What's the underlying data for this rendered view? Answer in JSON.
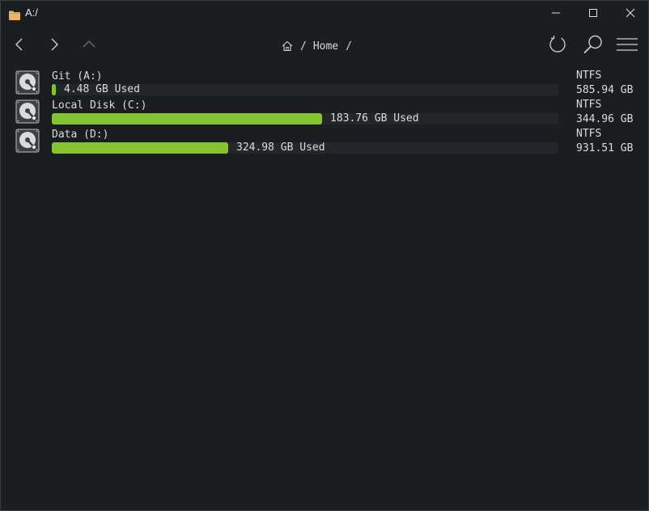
{
  "window": {
    "title": "A:/",
    "icon": "folder-icon"
  },
  "toolbar": {
    "back_icon": "chevron-left-icon",
    "forward_icon": "chevron-right-icon",
    "up_icon": "chevron-up-icon",
    "refresh_icon": "refresh-icon",
    "search_icon": "search-icon",
    "menu_icon": "hamburger-menu-icon"
  },
  "breadcrumb": {
    "home_icon": "home-icon",
    "separator": "/",
    "items": [
      "Home"
    ]
  },
  "drives": [
    {
      "name": "Git (A:)",
      "used_label": "4.48 GB Used",
      "used_fraction": 0.0076,
      "filesystem": "NTFS",
      "total": "585.94 GB"
    },
    {
      "name": "Local Disk (C:)",
      "used_label": "183.76 GB Used",
      "used_fraction": 0.534,
      "filesystem": "NTFS",
      "total": "344.96 GB"
    },
    {
      "name": "Data (D:)",
      "used_label": "324.98 GB Used",
      "used_fraction": 0.349,
      "filesystem": "NTFS",
      "total": "931.51 GB"
    }
  ],
  "colors": {
    "background": "#1b1e21",
    "bar_track": "#23262a",
    "bar_fill": "#84c433",
    "text": "#dcdcdc",
    "folder": "#e8b566"
  }
}
